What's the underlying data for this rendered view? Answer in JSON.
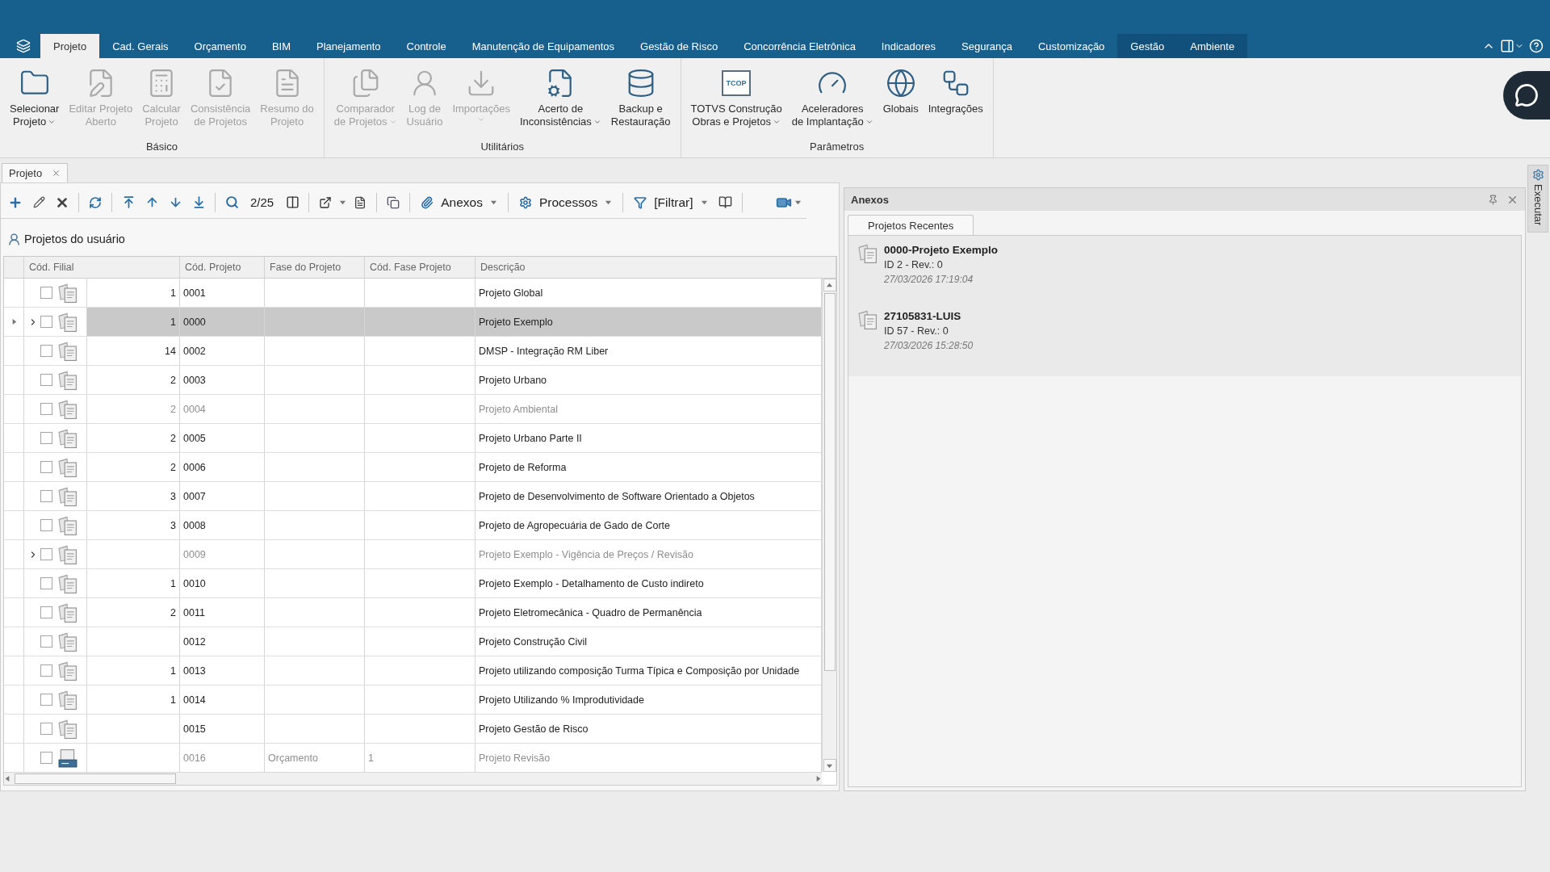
{
  "ribbon_tabs": [
    {
      "label": "Projeto",
      "selected": true,
      "contextual": false
    },
    {
      "label": "Cad. Gerais",
      "selected": false,
      "contextual": false
    },
    {
      "label": "Orçamento",
      "selected": false,
      "contextual": false
    },
    {
      "label": "BIM",
      "selected": false,
      "contextual": false
    },
    {
      "label": "Planejamento",
      "selected": false,
      "contextual": false
    },
    {
      "label": "Controle",
      "selected": false,
      "contextual": false
    },
    {
      "label": "Manutenção de Equipamentos",
      "selected": false,
      "contextual": false
    },
    {
      "label": "Gestão de Risco",
      "selected": false,
      "contextual": false
    },
    {
      "label": "Concorrência Eletrônica",
      "selected": false,
      "contextual": false
    },
    {
      "label": "Indicadores",
      "selected": false,
      "contextual": false
    },
    {
      "label": "Segurança",
      "selected": false,
      "contextual": false
    },
    {
      "label": "Customização",
      "selected": false,
      "contextual": false
    },
    {
      "label": "Gestão",
      "selected": false,
      "contextual": true
    },
    {
      "label": "Ambiente",
      "selected": false,
      "contextual": true
    }
  ],
  "ribbon_groups": [
    {
      "label": "Básico",
      "buttons": [
        {
          "label_lines": [
            "Selecionar",
            "Projeto"
          ],
          "disabled": false,
          "dropdown": true
        },
        {
          "label_lines": [
            "Editar Projeto",
            "Aberto"
          ],
          "disabled": true,
          "dropdown": false
        },
        {
          "label_lines": [
            "Calcular",
            "Projeto"
          ],
          "disabled": true,
          "dropdown": false
        },
        {
          "label_lines": [
            "Consistência",
            "de Projetos"
          ],
          "disabled": true,
          "dropdown": false
        },
        {
          "label_lines": [
            "Resumo do",
            "Projeto"
          ],
          "disabled": true,
          "dropdown": false
        }
      ]
    },
    {
      "label": "Utilitários",
      "buttons": [
        {
          "label_lines": [
            "Comparador",
            "de Projetos"
          ],
          "disabled": true,
          "dropdown": true
        },
        {
          "label_lines": [
            "Log de",
            "Usuário"
          ],
          "disabled": true,
          "dropdown": false
        },
        {
          "label_lines": [
            "Importações"
          ],
          "disabled": true,
          "dropdown": true
        },
        {
          "label_lines": [
            "Acerto de",
            "Inconsistências"
          ],
          "disabled": false,
          "dropdown": true
        },
        {
          "label_lines": [
            "Backup e",
            "Restauração"
          ],
          "disabled": false,
          "dropdown": false
        }
      ]
    },
    {
      "label": "Parâmetros",
      "buttons": [
        {
          "label_lines": [
            "TOTVS Construção",
            "Obras e Projetos"
          ],
          "disabled": false,
          "dropdown": true,
          "badge": "TCOP"
        },
        {
          "label_lines": [
            "Aceleradores",
            "de Implantação"
          ],
          "disabled": false,
          "dropdown": true
        },
        {
          "label_lines": [
            "Globais"
          ],
          "disabled": false,
          "dropdown": false
        },
        {
          "label_lines": [
            "Integrações"
          ],
          "disabled": false,
          "dropdown": false
        }
      ]
    }
  ],
  "document_tabs": [
    {
      "label": "Projeto",
      "selected": true
    }
  ],
  "toolbar": {
    "counter": "2/25",
    "menus": [
      "Anexos",
      "Processos",
      "[Filtrar]"
    ]
  },
  "grid": {
    "title": "Projetos do usuário",
    "columns": [
      "Cód. Filial",
      "Cód. Projeto",
      "Fase do Projeto",
      "Cód. Fase Projeto",
      "Descrição"
    ],
    "rows": [
      {
        "kind": "project",
        "selected": false,
        "expandable": false,
        "checked": false,
        "dimmed": false,
        "filial": "1",
        "code": "0001",
        "description": "Projeto Global"
      },
      {
        "kind": "project",
        "selected": true,
        "expandable": true,
        "checked": false,
        "dimmed": false,
        "filial": "1",
        "code": "0000",
        "description": "Projeto Exemplo"
      },
      {
        "kind": "project",
        "selected": false,
        "expandable": false,
        "checked": false,
        "dimmed": false,
        "filial": "14",
        "code": "0002",
        "description": "DMSP - Integração RM Liber"
      },
      {
        "kind": "project",
        "selected": false,
        "expandable": false,
        "checked": false,
        "dimmed": false,
        "filial": "2",
        "code": "0003",
        "description": "Projeto Urbano"
      },
      {
        "kind": "project",
        "selected": false,
        "expandable": false,
        "checked": false,
        "dimmed": true,
        "filial": "2",
        "code": "0004",
        "description": "Projeto Ambiental"
      },
      {
        "kind": "project",
        "selected": false,
        "expandable": false,
        "checked": false,
        "dimmed": false,
        "filial": "2",
        "code": "0005",
        "description": "Projeto Urbano Parte II"
      },
      {
        "kind": "project",
        "selected": false,
        "expandable": false,
        "checked": false,
        "dimmed": false,
        "filial": "2",
        "code": "0006",
        "description": "Projeto de Reforma"
      },
      {
        "kind": "project",
        "selected": false,
        "expandable": false,
        "checked": false,
        "dimmed": false,
        "filial": "3",
        "code": "0007",
        "description": "Projeto de Desenvolvimento de Software Orientado a Objetos"
      },
      {
        "kind": "project",
        "selected": false,
        "expandable": false,
        "checked": false,
        "dimmed": false,
        "filial": "3",
        "code": "0008",
        "description": "Projeto de Agropecuária de Gado de Corte"
      },
      {
        "kind": "project",
        "selected": false,
        "expandable": true,
        "checked": false,
        "dimmed": true,
        "code": "0009",
        "description": "Projeto Exemplo - Vigência de Preços / Revisão"
      },
      {
        "kind": "project",
        "selected": false,
        "expandable": false,
        "checked": false,
        "dimmed": false,
        "filial": "1",
        "code": "0010",
        "description": "Projeto Exemplo - Detalhamento de Custo indireto"
      },
      {
        "kind": "project",
        "selected": false,
        "expandable": false,
        "checked": false,
        "dimmed": false,
        "filial": "2",
        "code": "0011",
        "description": "Projeto Eletromecânica - Quadro de Permanência"
      },
      {
        "kind": "project",
        "selected": false,
        "expandable": false,
        "checked": false,
        "dimmed": false,
        "code": "0012",
        "description": "Projeto Construção Civil"
      },
      {
        "kind": "project",
        "selected": false,
        "expandable": false,
        "checked": false,
        "dimmed": false,
        "filial": "1",
        "code": "0013",
        "description": "Projeto utilizando composição Turma Típica e Composição por Unidade"
      },
      {
        "kind": "project",
        "selected": false,
        "expandable": false,
        "checked": false,
        "dimmed": false,
        "filial": "1",
        "code": "0014",
        "description": "Projeto Utilizando % Improdutividade"
      },
      {
        "kind": "project",
        "selected": false,
        "expandable": false,
        "checked": false,
        "dimmed": false,
        "code": "0015",
        "description": "Projeto Gestão de Risco"
      },
      {
        "kind": "revision",
        "selected": false,
        "expandable": false,
        "checked": false,
        "dimmed": true,
        "code": "0016",
        "phase": "Orçamento",
        "phase_code": "1",
        "description": "Projeto Revisão"
      }
    ]
  },
  "attachments_panel": {
    "title": "Anexos",
    "tabs": [
      {
        "label": "Projetos Recentes",
        "selected": true
      }
    ],
    "recent": [
      {
        "title": "0000-Projeto Exemplo",
        "subtitle": "ID 2 - Rev.: 0",
        "timestamp": "27/03/2026 17:19:04"
      },
      {
        "title": "27105831-LUIS",
        "subtitle": "ID 57 - Rev.: 0",
        "timestamp": "27/03/2026 15:28:50"
      }
    ]
  },
  "side_strip": {
    "label": "Executar"
  }
}
